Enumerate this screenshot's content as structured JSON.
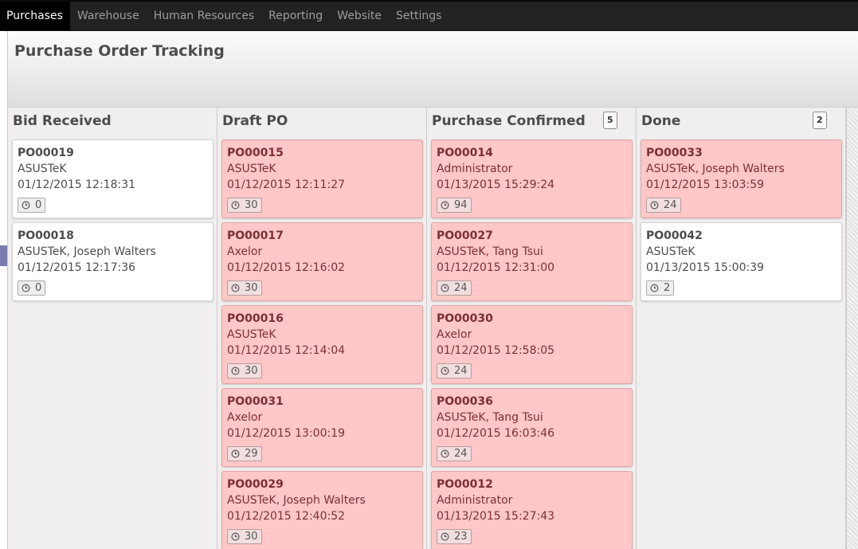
{
  "nav": {
    "items": [
      {
        "label": "Purchases",
        "active": true
      },
      {
        "label": "Warehouse",
        "active": false
      },
      {
        "label": "Human Resources",
        "active": false
      },
      {
        "label": "Reporting",
        "active": false
      },
      {
        "label": "Website",
        "active": false
      },
      {
        "label": "Settings",
        "active": false
      }
    ]
  },
  "header": {
    "title": "Purchase Order Tracking"
  },
  "colors": {
    "accent": "#7c7bad",
    "card_red": "#ffc7c7",
    "navbar": "#222222"
  },
  "columns": [
    {
      "title": "Bid Received",
      "count": "",
      "cards": [
        {
          "ref": "PO00019",
          "partner": "ASUSTeK",
          "date": "01/12/2015 12:18:31",
          "tag": "0",
          "red": false,
          "icon": "clock-icon"
        },
        {
          "ref": "PO00018",
          "partner": "ASUSTeK, Joseph Walters",
          "date": "01/12/2015 12:17:36",
          "tag": "0",
          "red": false,
          "icon": "clock-icon"
        }
      ]
    },
    {
      "title": "Draft PO",
      "count": "",
      "cards": [
        {
          "ref": "PO00015",
          "partner": "ASUSTeK",
          "date": "01/12/2015 12:11:27",
          "tag": "30",
          "red": true,
          "icon": "clock-icon"
        },
        {
          "ref": "PO00017",
          "partner": "Axelor",
          "date": "01/12/2015 12:16:02",
          "tag": "30",
          "red": true,
          "icon": "clock-icon"
        },
        {
          "ref": "PO00016",
          "partner": "ASUSTeK",
          "date": "01/12/2015 12:14:04",
          "tag": "30",
          "red": true,
          "icon": "clock-icon"
        },
        {
          "ref": "PO00031",
          "partner": "Axelor",
          "date": "01/12/2015 13:00:19",
          "tag": "29",
          "red": true,
          "icon": "clock-icon"
        },
        {
          "ref": "PO00029",
          "partner": "ASUSTeK, Joseph Walters",
          "date": "01/12/2015 12:40:52",
          "tag": "30",
          "red": true,
          "icon": "clock-icon"
        }
      ]
    },
    {
      "title": "Purchase Confirmed",
      "count": "5",
      "cards": [
        {
          "ref": "PO00014",
          "partner": "Administrator",
          "date": "01/13/2015 15:29:24",
          "tag": "94",
          "red": true,
          "icon": "clock-icon"
        },
        {
          "ref": "PO00027",
          "partner": "ASUSTeK, Tang Tsui",
          "date": "01/12/2015 12:31:00",
          "tag": "24",
          "red": true,
          "icon": "clock-icon"
        },
        {
          "ref": "PO00030",
          "partner": "Axelor",
          "date": "01/12/2015 12:58:05",
          "tag": "24",
          "red": true,
          "icon": "clock-icon"
        },
        {
          "ref": "PO00036",
          "partner": "ASUSTeK, Tang Tsui",
          "date": "01/12/2015 16:03:46",
          "tag": "24",
          "red": true,
          "icon": "clock-icon"
        },
        {
          "ref": "PO00012",
          "partner": "Administrator",
          "date": "01/13/2015 15:27:43",
          "tag": "23",
          "red": true,
          "icon": "clock-icon"
        }
      ]
    },
    {
      "title": "Done",
      "count": "2",
      "cards": [
        {
          "ref": "PO00033",
          "partner": "ASUSTeK, Joseph Walters",
          "date": "01/12/2015 13:03:59",
          "tag": "24",
          "red": true,
          "icon": "clock-icon"
        },
        {
          "ref": "PO00042",
          "partner": "ASUSTeK",
          "date": "01/13/2015 15:00:39",
          "tag": "2",
          "red": false,
          "icon": "clock-icon"
        }
      ]
    }
  ]
}
